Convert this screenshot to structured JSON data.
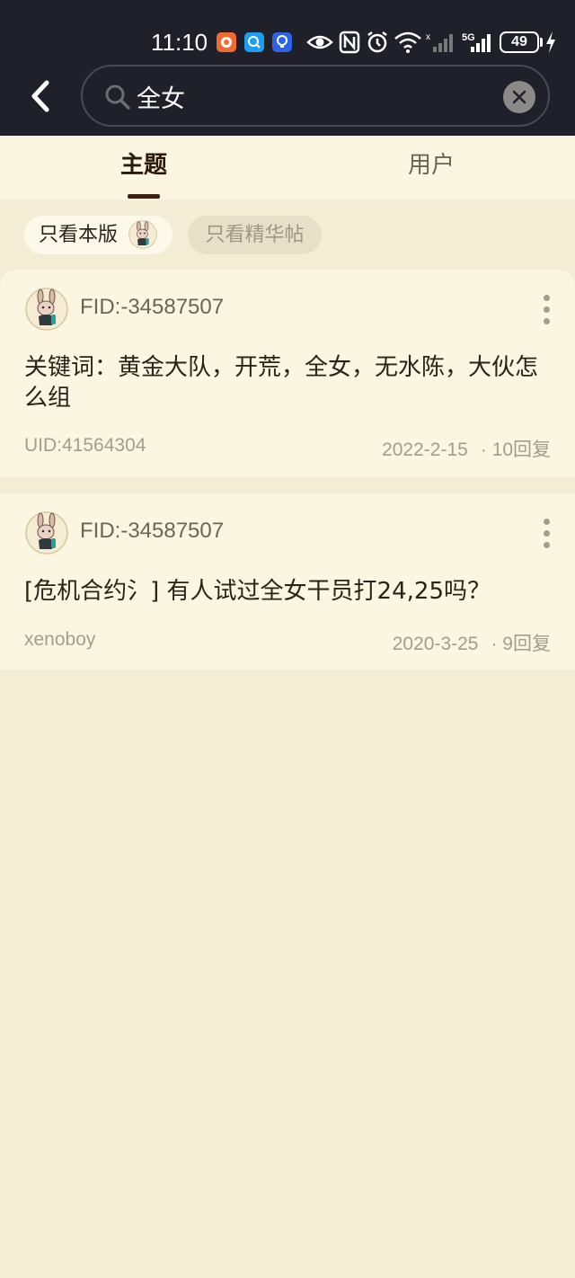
{
  "status_bar": {
    "time": "11:10",
    "battery": "49",
    "icons": [
      "app-notification-orange",
      "search-app-icon",
      "bulb-app-icon",
      "eye-icon",
      "nfc-icon",
      "alarm-icon",
      "wifi-icon",
      "signal-icon",
      "5g-signal-icon",
      "battery-icon",
      "charging-icon"
    ]
  },
  "search": {
    "value": "全女",
    "placeholder": ""
  },
  "tabs": [
    {
      "label": "主题",
      "active": true
    },
    {
      "label": "用户",
      "active": false
    }
  ],
  "filters": [
    {
      "label": "只看本版",
      "active": true
    },
    {
      "label": "只看精华帖",
      "active": false
    }
  ],
  "results": [
    {
      "fid": "FID:-34587507",
      "title": "关键词：黄金大队，开荒，全女，无水陈，大伙怎么组",
      "author": "UID:41564304",
      "date": "2022-2-15",
      "replies": "· 10回复"
    },
    {
      "fid": "FID:-34587507",
      "title": "[危机合约氵] 有人试过全女干员打24,25吗？",
      "author": "xenoboy",
      "date": "2020-3-25",
      "replies": "· 9回复"
    }
  ],
  "colors": {
    "header_bg": "#20202a",
    "tab_bg": "#fbf6e1",
    "page_bg": "#f3edd6",
    "text_primary": "#2b2219",
    "text_secondary": "#a39d90"
  }
}
